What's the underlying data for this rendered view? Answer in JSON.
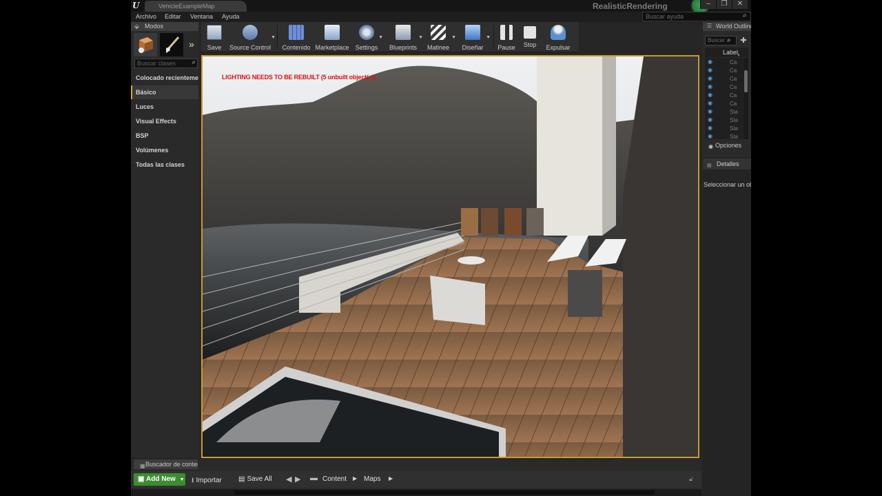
{
  "window": {
    "tab_title": "VehicleExampleMap",
    "project_name": "RealisticRendering",
    "controls": [
      "–",
      "❐",
      "✕"
    ]
  },
  "menu": {
    "items": [
      "Archivo",
      "Editar",
      "Ventana",
      "Ayuda"
    ],
    "help_search_placeholder": "Buscar ayuda"
  },
  "modes_panel": {
    "tab_label": "Modos",
    "class_search_placeholder": "Buscar clases",
    "categories": [
      {
        "label": "Colocado recientemente",
        "active": false
      },
      {
        "label": "Básico",
        "active": true
      },
      {
        "label": "Luces",
        "active": false
      },
      {
        "label": "Visual Effects",
        "active": false
      },
      {
        "label": "BSP",
        "active": false
      },
      {
        "label": "Volúmenes",
        "active": false
      },
      {
        "label": "Todas las clases",
        "active": false
      }
    ]
  },
  "toolbar": {
    "buttons": [
      {
        "label": "Save",
        "icon": "save-icon",
        "color": "#8fb3d9"
      },
      {
        "label": "Source Control",
        "icon": "source-control-icon",
        "color": "#7d9ec9"
      },
      {
        "label": "Contenido",
        "icon": "content-icon",
        "color": "#6f8ed4"
      },
      {
        "label": "Marketplace",
        "icon": "marketplace-icon",
        "color": "#a7bfe0"
      },
      {
        "label": "Settings",
        "icon": "settings-icon",
        "color": "#8aa4c4"
      },
      {
        "label": "Blueprints",
        "icon": "blueprints-icon",
        "color": "#9ab0cc"
      },
      {
        "label": "Matinee",
        "icon": "matinee-icon",
        "color": "#b0b8c8"
      },
      {
        "label": "Diseñar",
        "icon": "build-icon",
        "color": "#6aa0e0"
      },
      {
        "label": "Pause",
        "icon": "pause-icon",
        "color": "#d8d8d8"
      },
      {
        "label": "Stop",
        "icon": "stop-icon",
        "color": "#d8d8d8"
      },
      {
        "label": "Expulsar",
        "icon": "eject-icon",
        "color": "#8cb4e0"
      }
    ]
  },
  "viewport": {
    "warning": "LIGHTING NEEDS TO BE REBUILT (5 unbuilt object(s))",
    "border_color": "#c89b30"
  },
  "world_outliner": {
    "tab_label": "World Outliner",
    "search_placeholder": "Buscar",
    "column_label": "Label",
    "rows": [
      "Ca",
      "Ca",
      "Ca",
      "Ca",
      "Ca",
      "Ca",
      "Sta",
      "Sta",
      "Sta",
      "Sta"
    ],
    "options_label": "Opciones"
  },
  "details": {
    "tab_label": "Detalles",
    "hint": "Seleccionar un objeto"
  },
  "content_browser": {
    "tab_label": "Buscador de contenido",
    "add_new_label": "Add New",
    "import_label": "Importar",
    "save_all_label": "Save All",
    "breadcrumbs": [
      "Content",
      "Maps"
    ],
    "accent_color": "#3d8c32"
  }
}
